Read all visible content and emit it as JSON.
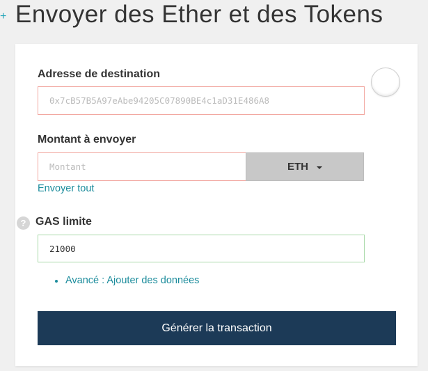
{
  "header": {
    "title": "Envoyer des Ether et des Tokens",
    "plus_glyph": "+"
  },
  "form": {
    "destination": {
      "label": "Adresse de destination",
      "placeholder": "0x7cB57B5A97eAbe94205C07890BE4c1aD31E486A8"
    },
    "amount": {
      "label": "Montant à envoyer",
      "placeholder": "Montant",
      "unit_selected": "ETH",
      "send_all_label": "Envoyer tout"
    },
    "gas": {
      "label": "GAS limite",
      "help_glyph": "?",
      "value": "21000"
    },
    "advanced_link": "Avancé : Ajouter des données",
    "generate_button": "Générer la transaction"
  },
  "colors": {
    "accent": "#1c8c9c",
    "button_bg": "#1c3a57",
    "invalid_border": "#f2a8a1",
    "valid_border": "#a8d9a8"
  }
}
